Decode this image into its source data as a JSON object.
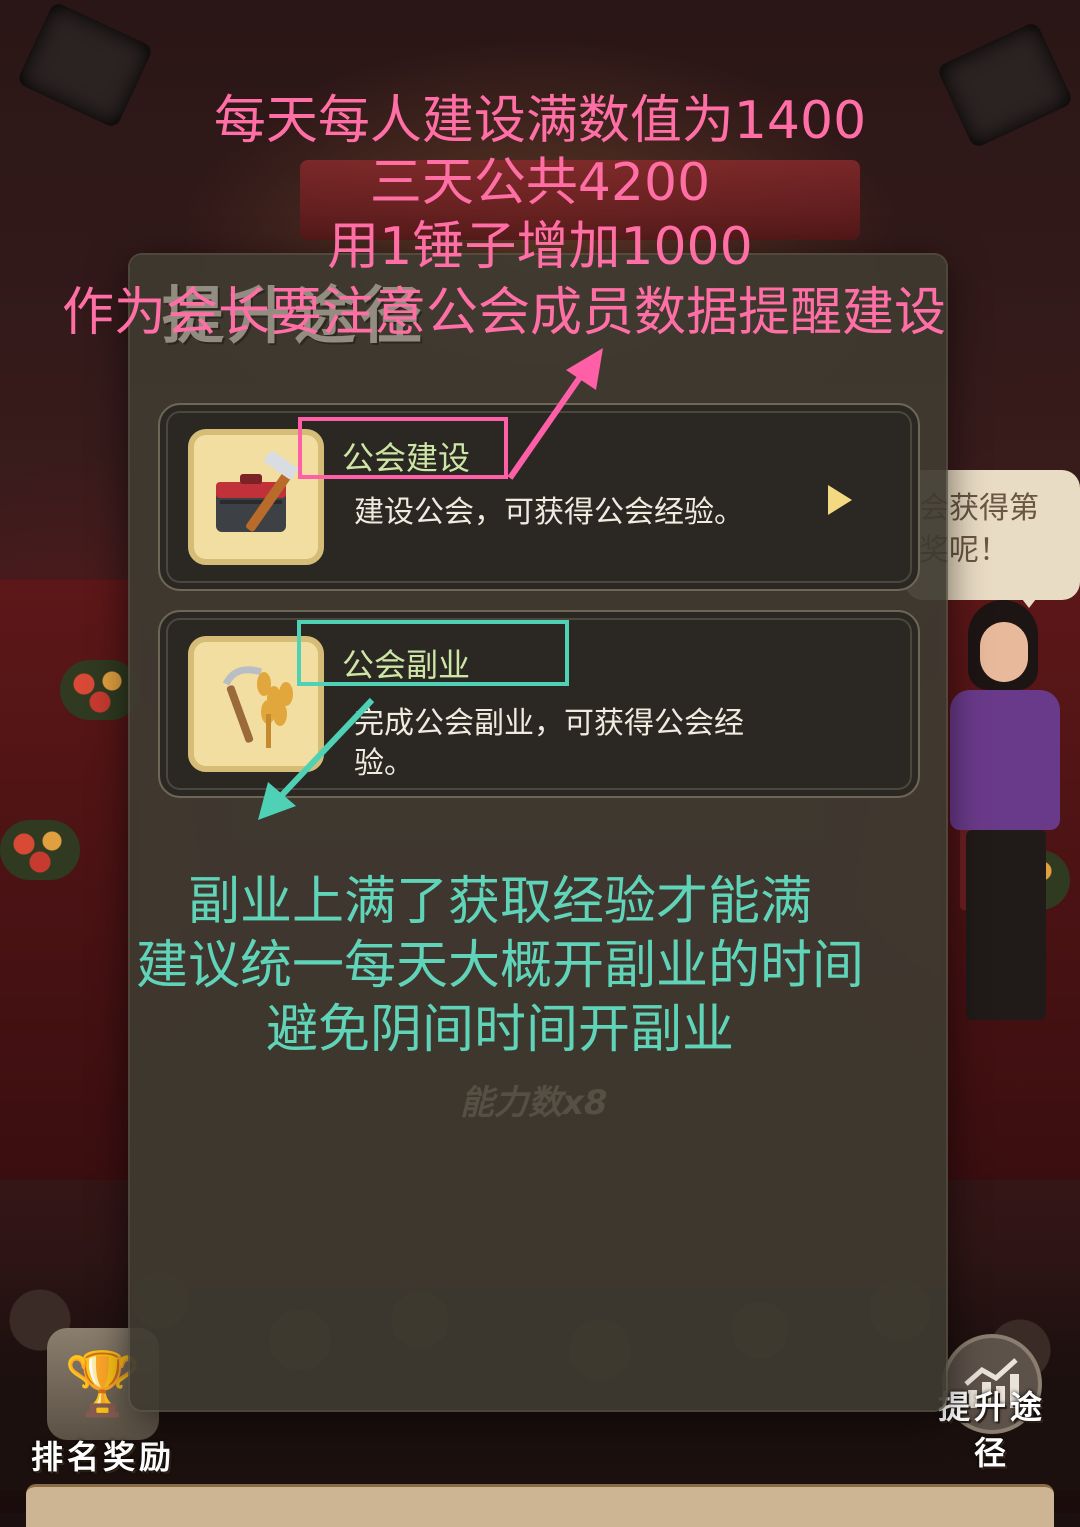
{
  "annotations": {
    "pink_lines": [
      "每天每人建设满数值为1400",
      "三天公共4200",
      "用1锤子增加1000",
      "作为会长要注意公会成员数据提醒建设"
    ],
    "teal_lines": [
      "副业上满了获取经验才能满",
      "建议统一每天大概开副业的时间",
      "避免阴间时间开副业"
    ],
    "pink_color": "#ff6fa6",
    "teal_color": "#5fd4b8"
  },
  "dialog": {
    "title": "提升途径",
    "items": [
      {
        "title": "公会建设",
        "desc": "建设公会，可获得公会经验。",
        "icon": "toolbox-hammer-icon"
      },
      {
        "title": "公会副业",
        "desc": "完成公会副业，可获得公会经验。",
        "icon": "wheat-sickle-icon"
      }
    ],
    "background_hint": "能力数x8"
  },
  "npc": {
    "speech": "会获得第\n奖呢！"
  },
  "side_buttons": {
    "rank_reward": "排名奖励",
    "upgrade_route": "提升途径"
  }
}
